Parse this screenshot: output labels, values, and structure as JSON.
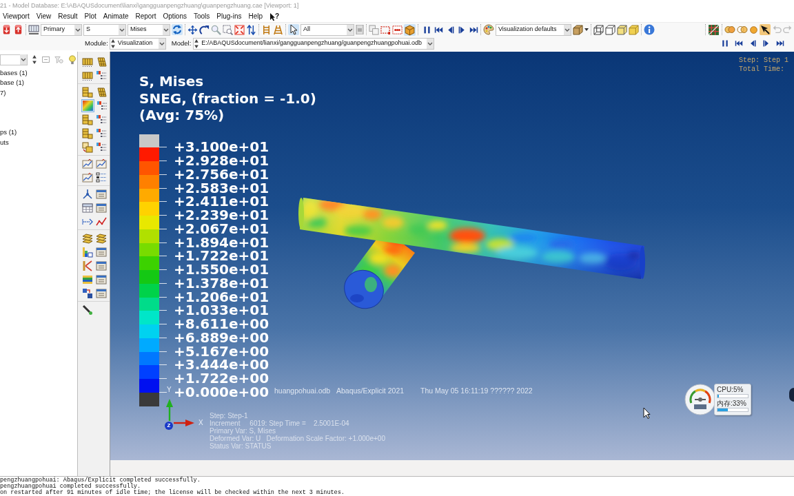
{
  "window": {
    "title": "21 - Model Database: E:\\ABAQUSdocument\\lianxi\\gangguanpengzhuang\\guanpengzhuang.cae [Viewport: 1]"
  },
  "menu": [
    "Viewport",
    "View",
    "Result",
    "Plot",
    "Animate",
    "Report",
    "Options",
    "Tools",
    "Plug-ins",
    "Help"
  ],
  "whats_this": {
    "label": "?"
  },
  "toolbar": {
    "result_type": "Primary",
    "field": "S",
    "invariant": "Mises",
    "sync_on": true,
    "selection_filter": "All",
    "pointer_on": true,
    "box_on": true,
    "options": "Visualization defaults",
    "tool_on": true
  },
  "context_bar": {
    "module_label": "Module:",
    "module": "Visualization",
    "model_label": "Model:",
    "model": "E:/ABAQUSdocument/lianxi/gangguanpengzhuang/guanpengzhuangpohuai.odb"
  },
  "model_tree": {
    "items": [
      "bases (1)",
      "base (1)",
      "7)",
      "ps (1)",
      "uts"
    ]
  },
  "toolbox": {
    "contour_on": true
  },
  "viewport": {
    "legend": {
      "title": [
        "S, Mises",
        "SNEG, (fraction = -1.0)",
        "(Avg: 75%)"
      ],
      "bands": [
        {
          "color": "#c8c8c8"
        },
        {
          "color": "#ff1a00"
        },
        {
          "color": "#ff5500"
        },
        {
          "color": "#ff8000"
        },
        {
          "color": "#ffaa00"
        },
        {
          "color": "#ffd200"
        },
        {
          "color": "#e8e800"
        },
        {
          "color": "#b0e000"
        },
        {
          "color": "#78dc00"
        },
        {
          "color": "#3cd200"
        },
        {
          "color": "#14c814"
        },
        {
          "color": "#00d24a"
        },
        {
          "color": "#00dc8a"
        },
        {
          "color": "#00e6c8"
        },
        {
          "color": "#00d2f0"
        },
        {
          "color": "#00aaff"
        },
        {
          "color": "#0078ff"
        },
        {
          "color": "#0040ff"
        },
        {
          "color": "#0010f0"
        },
        {
          "color": "#3a3a3a"
        }
      ],
      "labels": [
        "+3.100e+01",
        "+2.928e+01",
        "+2.756e+01",
        "+2.583e+01",
        "+2.411e+01",
        "+2.239e+01",
        "+2.067e+01",
        "+1.894e+01",
        "+1.722e+01",
        "+1.550e+01",
        "+1.378e+01",
        "+1.206e+01",
        "+1.033e+01",
        "+8.611e+00",
        "+6.889e+00",
        "+5.167e+00",
        "+3.444e+00",
        "+1.722e+00",
        "+0.000e+00"
      ]
    },
    "state_block": [
      "Step: Step 1",
      "Total Time:"
    ],
    "title_block": [
      "huangpohuai.odb",
      "Abaqus/Explicit 2021",
      "Thu May 05 16:11:19 ?????? 2022"
    ],
    "info_block": [
      "Step: Step-1",
      "Increment     6019: Step Time =    2.5001E-04",
      "Primary Var: S, Mises",
      "Deformed Var: U   Deformation Scale Factor: +1.000e+00",
      "Status Var: STATUS"
    ],
    "triad": {
      "x": "X",
      "y": "Y",
      "z": "Z"
    }
  },
  "monitor": {
    "cpu": {
      "label": "CPU:5%",
      "level": 0.05
    },
    "memory": {
      "label": "内存:33%",
      "level": 0.33
    }
  },
  "messages": [
    "pengzhuangpohuai: Abaqus/Explicit completed successfully.",
    "pengzhuangpohuai completed successfully.",
    "on restarted after 91 minutes of idle time; the license will be checked within the next 3 minutes."
  ]
}
